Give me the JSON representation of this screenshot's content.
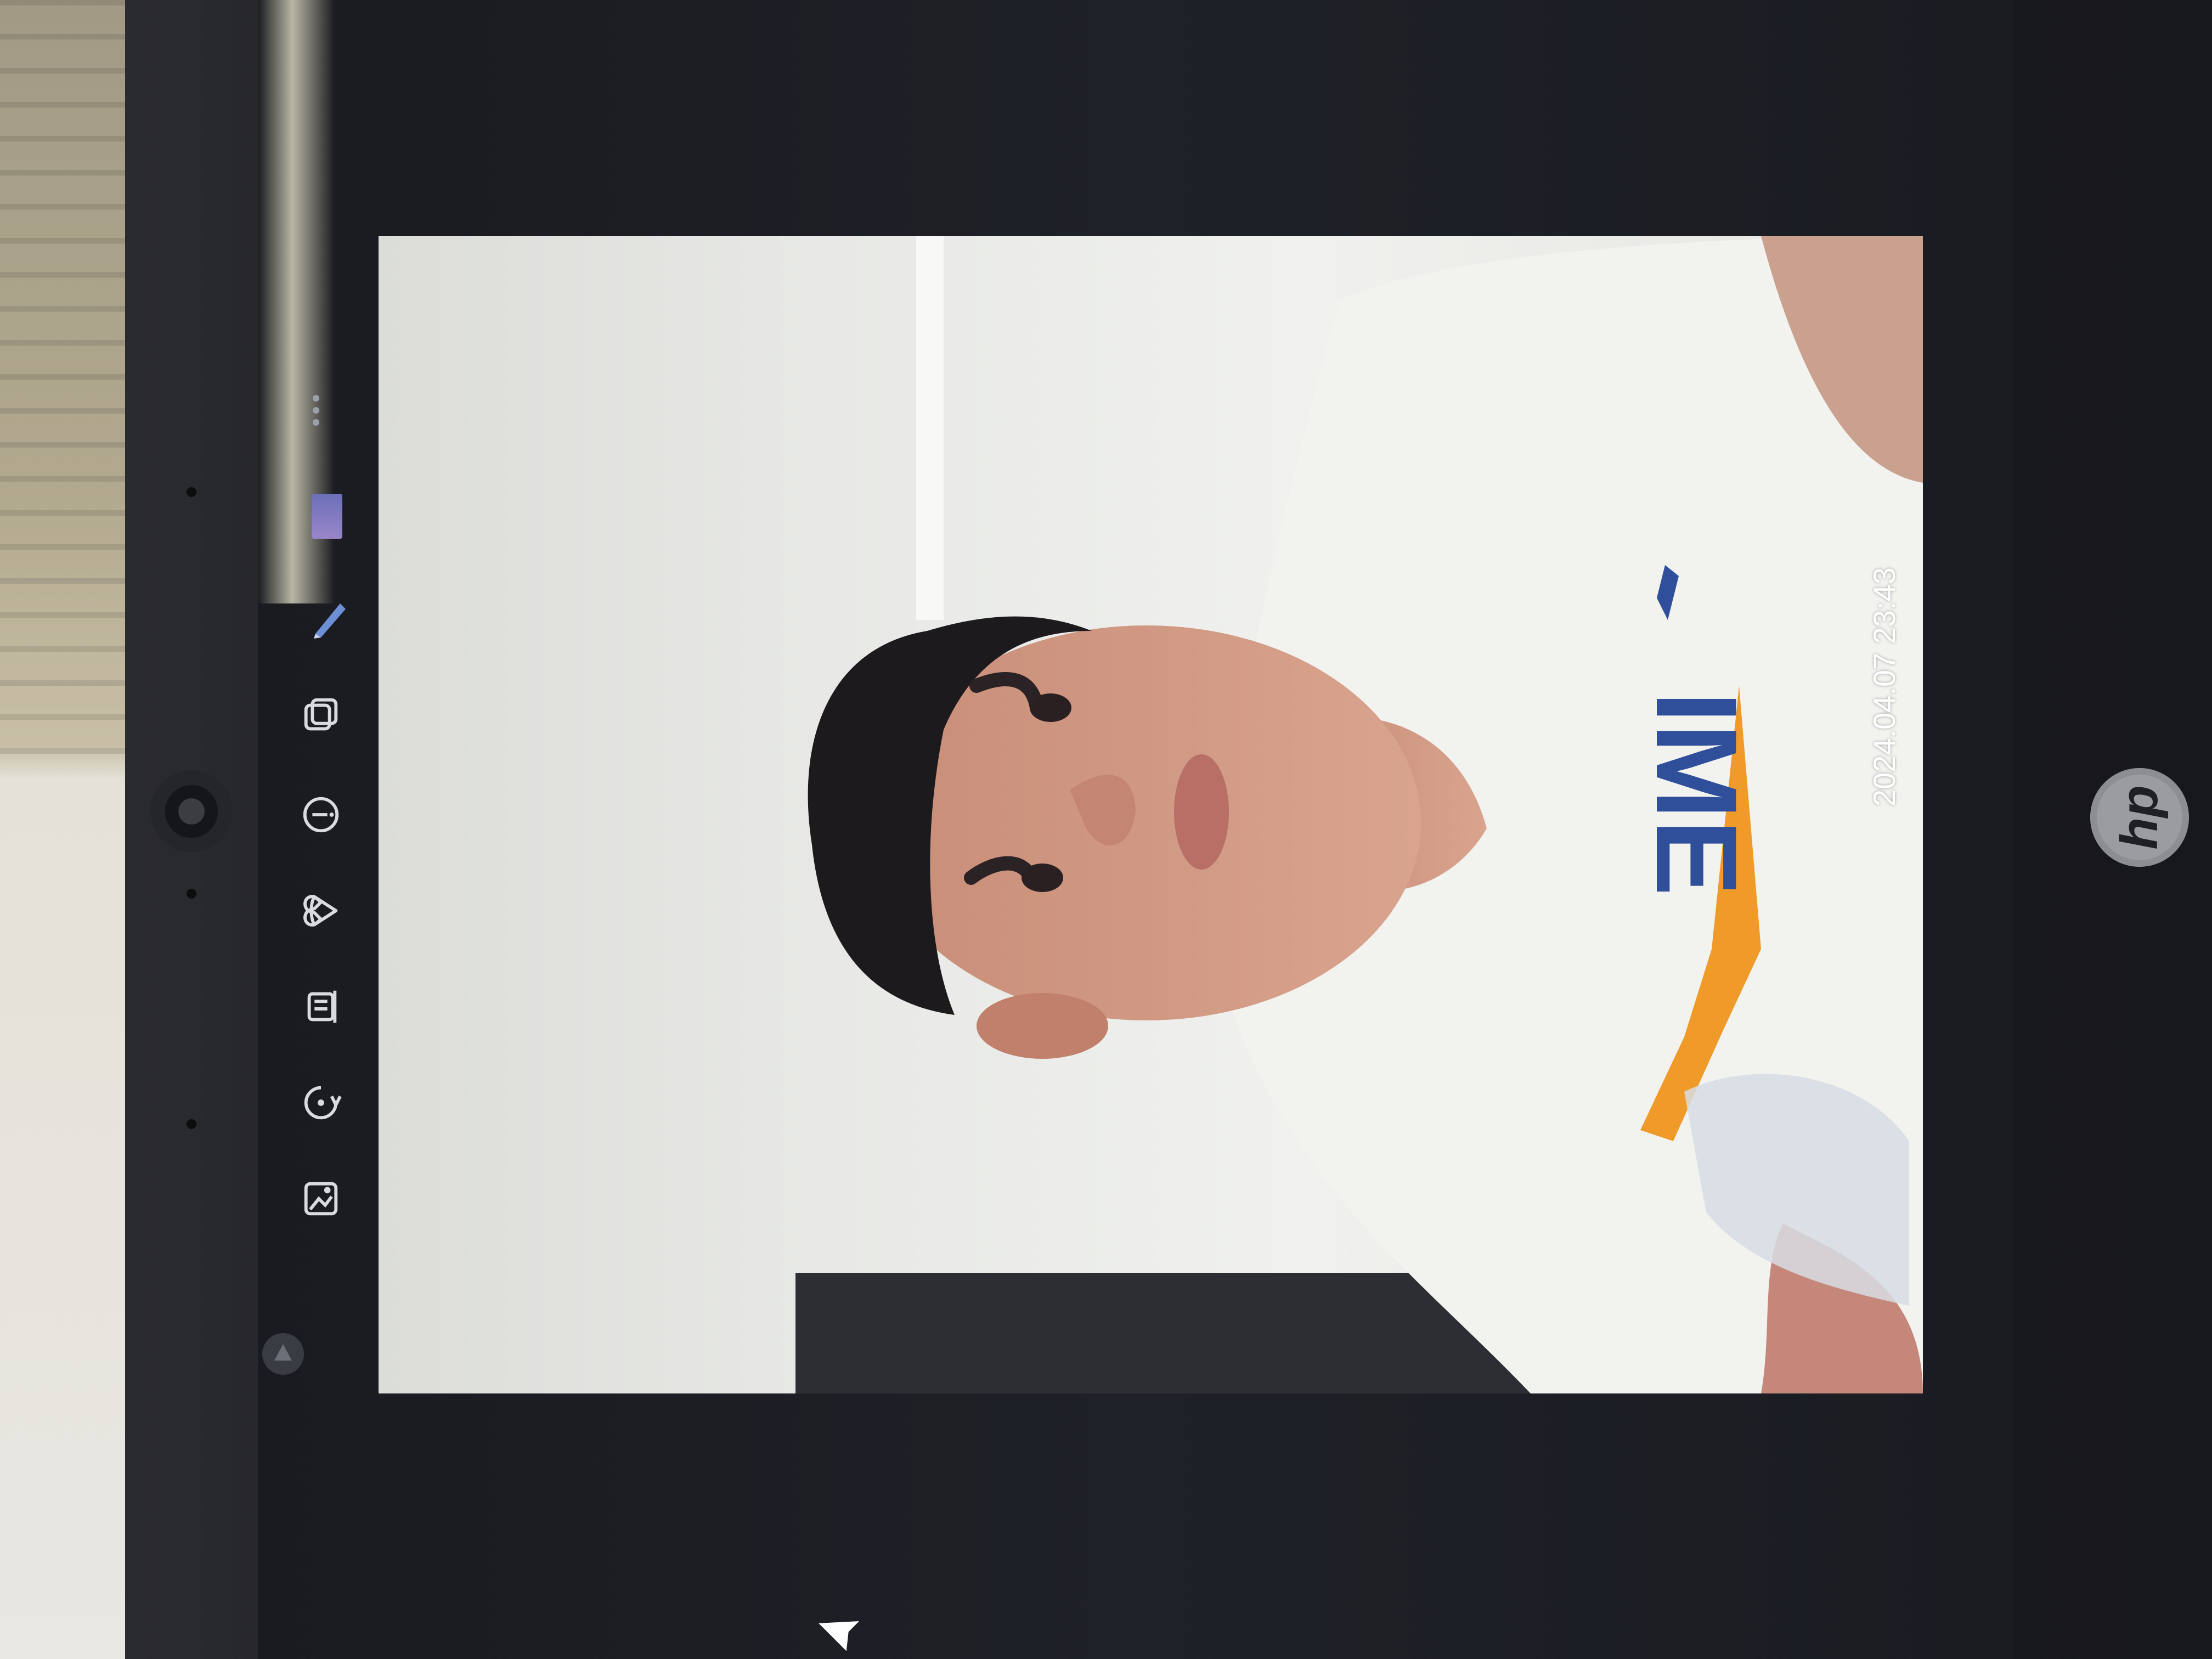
{
  "photo": {
    "timestamp": "2024.04.07 23:43",
    "shirt_text": "IME"
  },
  "toolbar": {
    "icons": [
      "edit-image-icon",
      "rotate-icon",
      "delete-icon",
      "favorite-icon",
      "info-icon",
      "copy-icon"
    ]
  },
  "device": {
    "brand_logo": "hp"
  },
  "colors": {
    "screen_bg": "#1f2128",
    "toolbar_icon": "#d8dbe0",
    "shirt": "#f2f2ef",
    "shirt_print_blue": "#2f4f9a",
    "shirt_print_orange": "#f09a2a"
  }
}
